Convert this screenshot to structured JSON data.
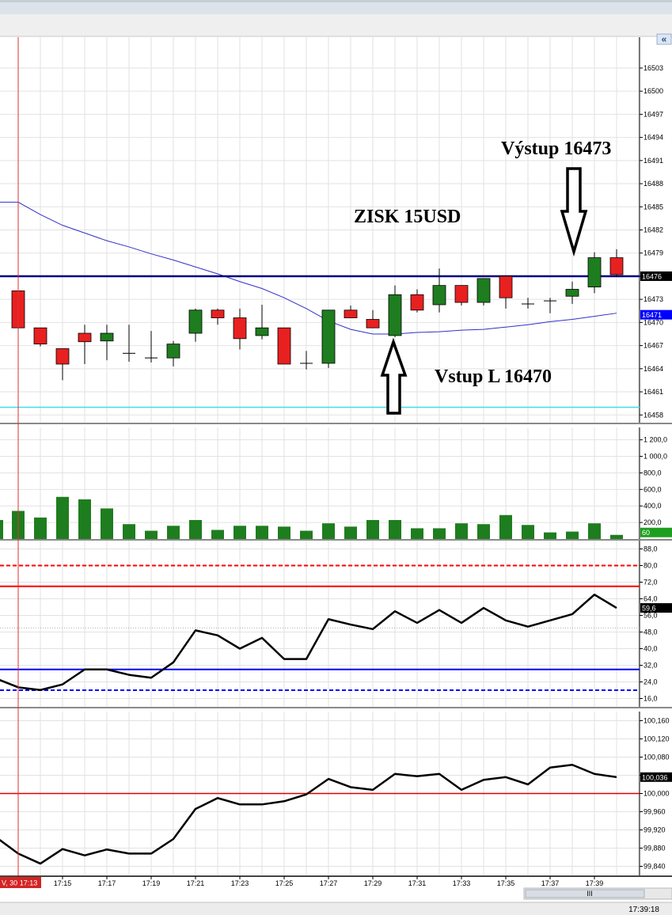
{
  "window": {
    "collapse_glyph": "«",
    "scroll_grip": "III",
    "status_time": "17:39:18",
    "cursor_time_label": "V, 30 17:13"
  },
  "annotations": {
    "exit": "Výstup 16473",
    "profit": "ZISK 15USD",
    "entry": "Vstup L 16470"
  },
  "colors": {
    "bull": "#1e7d1e",
    "bear": "#e82020",
    "sma": "#3030c8",
    "level": "#000080",
    "support": "#40e0e0",
    "cursor": "#e03030",
    "rsi_line": "#000000",
    "overbought": "#ff0000",
    "oversold": "#0000ff",
    "volume": "#1e7d1e",
    "ratio_line": "#000000",
    "ratio_ref": "#e00000"
  },
  "chart_data": [
    {
      "type": "candlestick",
      "name": "price",
      "x": [
        "17:13",
        "17:14",
        "17:15",
        "17:16",
        "17:17",
        "17:18",
        "17:19",
        "17:20",
        "17:21",
        "17:22",
        "17:23",
        "17:24",
        "17:25",
        "17:26",
        "17:27",
        "17:28",
        "17:29",
        "17:30",
        "17:31",
        "17:32",
        "17:33",
        "17:34",
        "17:35",
        "17:36",
        "17:37",
        "17:38",
        "17:39",
        "17:40"
      ],
      "ohlc": [
        [
          16474.1,
          16474.1,
          16469.3,
          16469.3
        ],
        [
          16469.3,
          16469.3,
          16466.9,
          16467.2
        ],
        [
          16466.6,
          16466.6,
          16462.5,
          16464.6
        ],
        [
          16468.6,
          16469.7,
          16464.6,
          16467.5
        ],
        [
          16467.6,
          16469.7,
          16465.1,
          16468.6
        ],
        [
          16466.0,
          16469.7,
          16464.9,
          16466.0
        ],
        [
          16465.4,
          16468.9,
          16464.8,
          16465.4
        ],
        [
          16465.4,
          16467.6,
          16464.3,
          16467.2
        ],
        [
          16468.6,
          16471.8,
          16467.5,
          16471.6
        ],
        [
          16471.6,
          16471.8,
          16469.7,
          16470.6
        ],
        [
          16470.6,
          16471.8,
          16466.5,
          16467.9
        ],
        [
          16468.3,
          16472.3,
          16467.8,
          16469.3
        ],
        [
          16469.3,
          16469.3,
          16464.6,
          16464.6
        ],
        [
          16464.7,
          16466.3,
          16463.9,
          16464.7
        ],
        [
          16464.7,
          16471.6,
          16464.1,
          16471.6
        ],
        [
          16471.6,
          16472.2,
          16470.6,
          16470.6
        ],
        [
          16470.4,
          16471.6,
          16469.3,
          16469.3
        ],
        [
          16468.3,
          16474.8,
          16468.1,
          16473.6
        ],
        [
          16473.6,
          16474.3,
          16471.3,
          16471.6
        ],
        [
          16472.3,
          16477.0,
          16471.3,
          16474.8
        ],
        [
          16474.8,
          16474.8,
          16472.2,
          16472.6
        ],
        [
          16472.6,
          16475.7,
          16472.2,
          16475.7
        ],
        [
          16476.0,
          16476.0,
          16471.8,
          16473.2
        ],
        [
          16472.4,
          16473.2,
          16471.8,
          16472.4
        ],
        [
          16472.8,
          16473.2,
          16471.2,
          16472.8
        ],
        [
          16473.4,
          16475.3,
          16472.4,
          16474.3
        ],
        [
          16474.6,
          16479.1,
          16473.8,
          16478.4
        ],
        [
          16478.4,
          16479.5,
          16475.9,
          16476.2
        ]
      ],
      "overlays": {
        "moving_average": [
          {
            "x": "17:13",
            "y": 16485.6
          },
          {
            "x": "17:14",
            "y": 16484.0
          },
          {
            "x": "17:15",
            "y": 16482.6
          },
          {
            "x": "17:16",
            "y": 16481.6
          },
          {
            "x": "17:17",
            "y": 16480.6
          },
          {
            "x": "17:18",
            "y": 16479.8
          },
          {
            "x": "17:19",
            "y": 16478.9
          },
          {
            "x": "17:20",
            "y": 16478.1
          },
          {
            "x": "17:21",
            "y": 16477.2
          },
          {
            "x": "17:22",
            "y": 16476.3
          },
          {
            "x": "17:23",
            "y": 16475.3
          },
          {
            "x": "17:24",
            "y": 16474.4
          },
          {
            "x": "17:25",
            "y": 16473.2
          },
          {
            "x": "17:26",
            "y": 16471.8
          },
          {
            "x": "17:27",
            "y": 16470.2
          },
          {
            "x": "17:28",
            "y": 16469.1
          },
          {
            "x": "17:29",
            "y": 16468.5
          },
          {
            "x": "17:30",
            "y": 16468.5
          },
          {
            "x": "17:31",
            "y": 16468.7
          },
          {
            "x": "17:32",
            "y": 16468.8
          },
          {
            "x": "17:33",
            "y": 16469.0
          },
          {
            "x": "17:34",
            "y": 16469.1
          },
          {
            "x": "17:35",
            "y": 16469.4
          },
          {
            "x": "17:36",
            "y": 16469.7
          },
          {
            "x": "17:37",
            "y": 16470.1
          },
          {
            "x": "17:38",
            "y": 16470.4
          },
          {
            "x": "17:39",
            "y": 16470.8
          },
          {
            "x": "17:40",
            "y": 16471.2
          }
        ],
        "level_line": 16476,
        "support_line": 16459,
        "cursor_x": "17:13"
      },
      "y_ticks": [
        "16458",
        "16461",
        "16464",
        "16467",
        "16470",
        "16473",
        "16476",
        "16479",
        "16482",
        "16485",
        "16488",
        "16491",
        "16494",
        "16497",
        "16500",
        "16503"
      ],
      "y_range": [
        16457,
        16507
      ],
      "price_badges": [
        {
          "label": "16476",
          "value": 16476,
          "style": "dark"
        },
        {
          "label": "16471",
          "value": 16471,
          "style": "blue"
        }
      ]
    },
    {
      "type": "bar",
      "name": "volume",
      "x": [
        "17:13",
        "17:14",
        "17:15",
        "17:16",
        "17:17",
        "17:18",
        "17:19",
        "17:20",
        "17:21",
        "17:22",
        "17:23",
        "17:24",
        "17:25",
        "17:26",
        "17:27",
        "17:28",
        "17:29",
        "17:30",
        "17:31",
        "17:32",
        "17:33",
        "17:34",
        "17:35",
        "17:36",
        "17:37",
        "17:38",
        "17:39",
        "17:40"
      ],
      "values": [
        340,
        260,
        510,
        480,
        370,
        180,
        100,
        160,
        230,
        110,
        160,
        160,
        150,
        100,
        190,
        150,
        230,
        230,
        130,
        130,
        190,
        180,
        290,
        170,
        80,
        90,
        190,
        50
      ],
      "partial_left_value": 230,
      "y_ticks": [
        "200,0",
        "400,0",
        "600,0",
        "800,0",
        "1 000,0",
        "1 200,0"
      ],
      "y_range": [
        0,
        1350
      ],
      "badge": {
        "label": "60",
        "value": 60
      }
    },
    {
      "type": "line",
      "name": "oscillator",
      "x": [
        "17:12",
        "17:13",
        "17:14",
        "17:15",
        "17:16",
        "17:17",
        "17:18",
        "17:19",
        "17:20",
        "17:21",
        "17:22",
        "17:23",
        "17:24",
        "17:25",
        "17:26",
        "17:27",
        "17:28",
        "17:29",
        "17:30",
        "17:31",
        "17:32",
        "17:33",
        "17:34",
        "17:35",
        "17:36",
        "17:37",
        "17:38",
        "17:39",
        "17:40"
      ],
      "values": [
        25.6,
        21.4,
        20.1,
        22.8,
        30.0,
        30.0,
        27.4,
        26.0,
        33.4,
        48.8,
        46.4,
        40.0,
        45.2,
        35.0,
        35.0,
        54.2,
        51.6,
        49.4,
        58.0,
        52.4,
        58.6,
        52.4,
        59.6,
        53.6,
        50.6,
        53.6,
        56.6,
        66.0,
        59.6
      ],
      "y_ticks": [
        "16,0",
        "24,0",
        "32,0",
        "40,0",
        "48,0",
        "56,0",
        "64,0",
        "72,0",
        "80,0",
        "88,0"
      ],
      "y_range": [
        12,
        92
      ],
      "levels": {
        "overbought_dashed": 80.0,
        "overbought": 70.0,
        "midline": 50.0,
        "oversold": 30.0,
        "oversold_dashed": 20.0
      },
      "badge": {
        "label": "59,6",
        "value": 59.6
      }
    },
    {
      "type": "line",
      "name": "ratio",
      "x": [
        "17:12",
        "17:13",
        "17:14",
        "17:15",
        "17:16",
        "17:17",
        "17:18",
        "17:19",
        "17:20",
        "17:21",
        "17:22",
        "17:23",
        "17:24",
        "17:25",
        "17:26",
        "17:27",
        "17:28",
        "17:29",
        "17:30",
        "17:31",
        "17:32",
        "17:33",
        "17:34",
        "17:35",
        "17:36",
        "17:37",
        "17:38",
        "17:39",
        "17:40"
      ],
      "values": [
        99.904,
        99.868,
        99.846,
        99.878,
        99.864,
        99.877,
        99.868,
        99.868,
        99.9,
        99.966,
        99.99,
        99.976,
        99.976,
        99.983,
        99.998,
        100.032,
        100.014,
        100.008,
        100.043,
        100.038,
        100.043,
        100.008,
        100.03,
        100.036,
        100.02,
        100.057,
        100.063,
        100.043,
        100.036
      ],
      "y_ticks": [
        "99,840",
        "99,880",
        "99,920",
        "99,960",
        "100,000",
        "100,040",
        "100,080",
        "100,120",
        "100,160"
      ],
      "y_range": [
        99.82,
        100.18
      ],
      "ref_line": 100.0,
      "badge": {
        "label": "100,036",
        "value": 100.036
      }
    }
  ],
  "x_axis_labels": [
    "17:15",
    "17:17",
    "17:19",
    "17:21",
    "17:23",
    "17:25",
    "17:27",
    "17:29",
    "17:31",
    "17:33",
    "17:35",
    "17:37",
    "17:39"
  ]
}
